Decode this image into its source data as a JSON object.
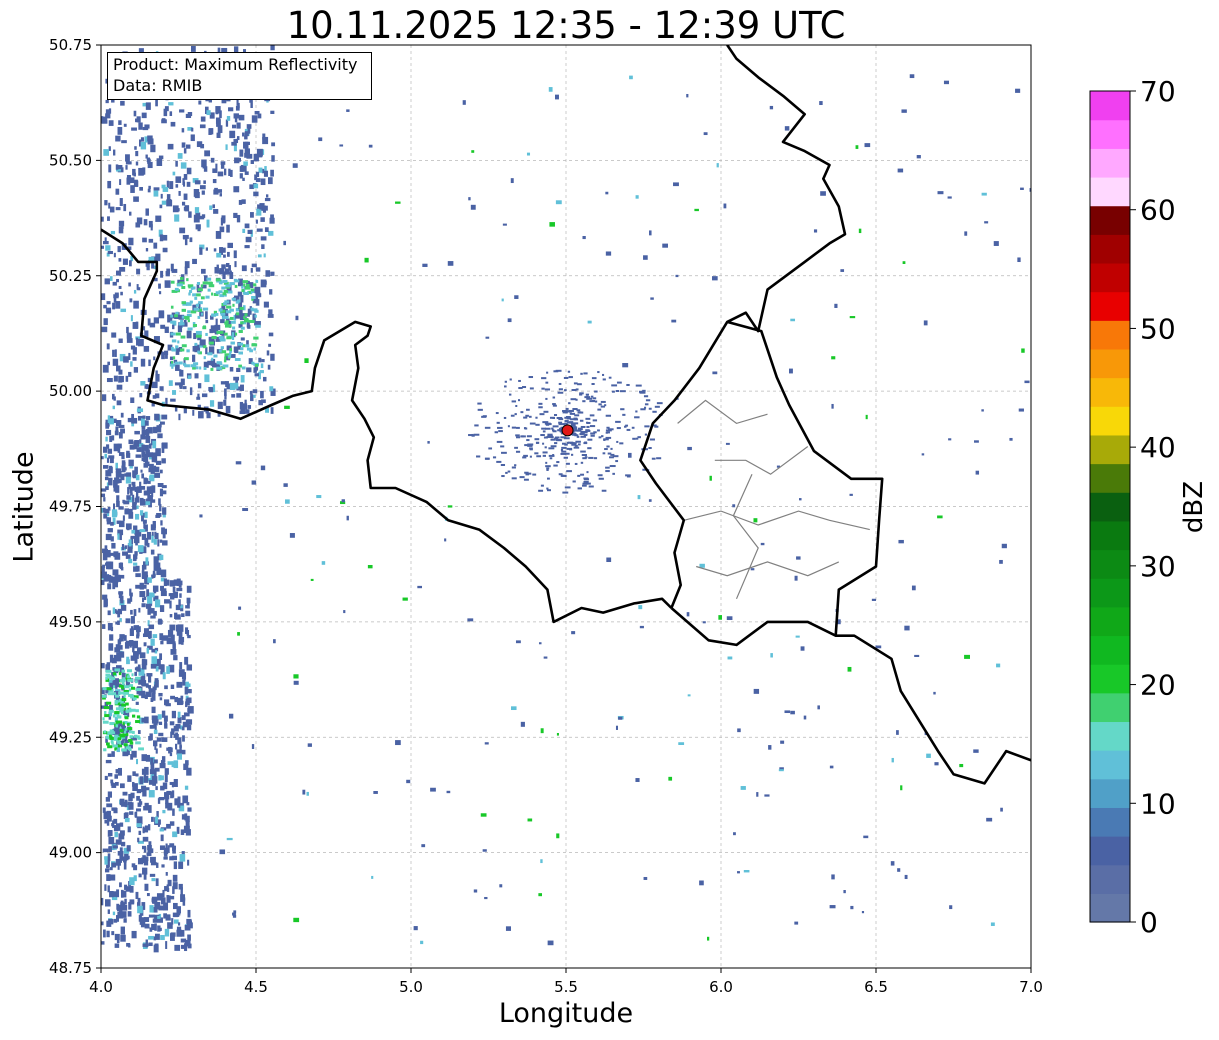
{
  "title": "10.11.2025 12:35 - 12:39 UTC",
  "xlabel": "Longitude",
  "ylabel": "Latitude",
  "info": {
    "product_line": "Product: Maximum Reflectivity",
    "data_line": "Data: RMIB"
  },
  "colorbar": {
    "label": "dBZ",
    "min": 0,
    "max": 70,
    "ticks": [
      0,
      10,
      20,
      30,
      40,
      50,
      60,
      70
    ],
    "tick_labels": [
      "0",
      "10",
      "20",
      "30",
      "40",
      "50",
      "60",
      "70"
    ],
    "colors": [
      "#6478a8",
      "#5a6ea6",
      "#4a62a4",
      "#4a7ab4",
      "#50a0c8",
      "#60c0d8",
      "#64d8c8",
      "#40d070",
      "#18c828",
      "#10b820",
      "#10a818",
      "#0c9818",
      "#0c8a14",
      "#0a7a10",
      "#0a6010",
      "#4a7a08",
      "#a8aa08",
      "#f8d808",
      "#f8b808",
      "#f89808",
      "#f87808",
      "#e80000",
      "#c00000",
      "#a00000",
      "#780000",
      "#ffd8ff",
      "#ffa8ff",
      "#ff70ff",
      "#f040f0"
    ]
  },
  "axes": {
    "xlim": [
      4.0,
      7.0
    ],
    "ylim": [
      48.75,
      50.75
    ],
    "xticks": [
      "4.0",
      "4.5",
      "5.0",
      "5.5",
      "6.0",
      "6.5",
      "7.0"
    ],
    "yticks": [
      "50.75",
      "50.50",
      "50.25",
      "50.00",
      "49.75",
      "49.50",
      "49.25",
      "49.00",
      "48.75"
    ],
    "grid": true
  },
  "radar_site": {
    "lon": 5.505,
    "lat": 49.915,
    "color": "#e01818"
  },
  "colors": {
    "border": "#000000",
    "subregion": "#808080",
    "grid": "#b8b8b8",
    "weak_echo": "#4a62a4",
    "moderate_echo": "#60c0d8",
    "green_echo": "#18c828"
  },
  "borders": {
    "france_belgium": [
      [
        4.0,
        50.35
      ],
      [
        4.07,
        50.32
      ],
      [
        4.12,
        50.28
      ],
      [
        4.18,
        50.28
      ],
      [
        4.18,
        50.26
      ],
      [
        4.14,
        50.2
      ],
      [
        4.13,
        50.12
      ],
      [
        4.2,
        50.1
      ],
      [
        4.17,
        50.05
      ],
      [
        4.15,
        49.98
      ],
      [
        4.2,
        49.97
      ],
      [
        4.35,
        49.96
      ],
      [
        4.45,
        49.94
      ],
      [
        4.55,
        49.97
      ],
      [
        4.62,
        49.99
      ],
      [
        4.68,
        50.0
      ],
      [
        4.69,
        50.05
      ],
      [
        4.72,
        50.11
      ],
      [
        4.82,
        50.15
      ],
      [
        4.87,
        50.14
      ],
      [
        4.86,
        50.12
      ],
      [
        4.82,
        50.1
      ],
      [
        4.83,
        50.05
      ],
      [
        4.81,
        49.98
      ],
      [
        4.85,
        49.94
      ],
      [
        4.88,
        49.9
      ],
      [
        4.86,
        49.85
      ],
      [
        4.87,
        49.79
      ],
      [
        4.95,
        49.79
      ],
      [
        5.05,
        49.76
      ],
      [
        5.12,
        49.72
      ],
      [
        5.22,
        49.7
      ],
      [
        5.3,
        49.66
      ],
      [
        5.37,
        49.62
      ],
      [
        5.44,
        49.57
      ],
      [
        5.46,
        49.5
      ],
      [
        5.55,
        49.53
      ],
      [
        5.62,
        49.52
      ],
      [
        5.72,
        49.54
      ],
      [
        5.81,
        49.55
      ],
      [
        5.84,
        49.53
      ]
    ],
    "belgium_lux": [
      [
        5.84,
        49.53
      ],
      [
        5.87,
        49.58
      ],
      [
        5.85,
        49.65
      ],
      [
        5.88,
        49.72
      ],
      [
        5.79,
        49.8
      ],
      [
        5.74,
        49.85
      ],
      [
        5.78,
        49.93
      ],
      [
        5.85,
        49.98
      ],
      [
        5.93,
        50.05
      ],
      [
        6.02,
        50.15
      ],
      [
        6.08,
        50.17
      ],
      [
        6.12,
        50.13
      ],
      [
        6.15,
        50.22
      ],
      [
        6.27,
        50.28
      ],
      [
        6.35,
        50.32
      ],
      [
        6.4,
        50.34
      ],
      [
        6.38,
        50.4
      ],
      [
        6.33,
        50.46
      ],
      [
        6.35,
        50.49
      ],
      [
        6.27,
        50.52
      ],
      [
        6.2,
        50.54
      ],
      [
        6.27,
        50.6
      ],
      [
        6.2,
        50.64
      ],
      [
        6.12,
        50.68
      ],
      [
        6.05,
        50.72
      ],
      [
        6.02,
        50.75
      ]
    ],
    "lux_germany": [
      [
        6.02,
        50.15
      ],
      [
        6.13,
        50.13
      ],
      [
        6.18,
        50.03
      ],
      [
        6.22,
        49.97
      ],
      [
        6.3,
        49.87
      ],
      [
        6.42,
        49.81
      ],
      [
        6.52,
        49.81
      ],
      [
        6.51,
        49.72
      ],
      [
        6.5,
        49.62
      ],
      [
        6.38,
        49.57
      ],
      [
        6.37,
        49.47
      ],
      [
        6.28,
        49.5
      ],
      [
        6.15,
        49.5
      ],
      [
        6.05,
        49.45
      ],
      [
        5.96,
        49.46
      ],
      [
        5.84,
        49.53
      ]
    ],
    "france_germany": [
      [
        6.37,
        49.47
      ],
      [
        6.43,
        49.47
      ],
      [
        6.55,
        49.42
      ],
      [
        6.58,
        49.35
      ],
      [
        6.7,
        49.22
      ],
      [
        6.75,
        49.17
      ],
      [
        6.85,
        49.15
      ],
      [
        6.92,
        49.22
      ],
      [
        7.0,
        49.2
      ]
    ],
    "lux_provinces": [
      [
        [
          5.86,
          49.93
        ],
        [
          5.95,
          49.98
        ],
        [
          6.05,
          49.93
        ],
        [
          6.15,
          49.95
        ]
      ],
      [
        [
          5.98,
          49.85
        ],
        [
          6.08,
          49.85
        ],
        [
          6.16,
          49.82
        ],
        [
          6.28,
          49.88
        ]
      ],
      [
        [
          5.88,
          49.72
        ],
        [
          6.0,
          49.74
        ],
        [
          6.12,
          49.71
        ],
        [
          6.25,
          49.74
        ],
        [
          6.35,
          49.72
        ],
        [
          6.48,
          49.7
        ]
      ],
      [
        [
          6.1,
          49.82
        ],
        [
          6.04,
          49.73
        ],
        [
          6.12,
          49.66
        ],
        [
          6.05,
          49.55
        ]
      ],
      [
        [
          5.92,
          49.62
        ],
        [
          6.02,
          49.6
        ],
        [
          6.15,
          49.63
        ],
        [
          6.28,
          49.6
        ],
        [
          6.38,
          49.63
        ]
      ]
    ]
  }
}
